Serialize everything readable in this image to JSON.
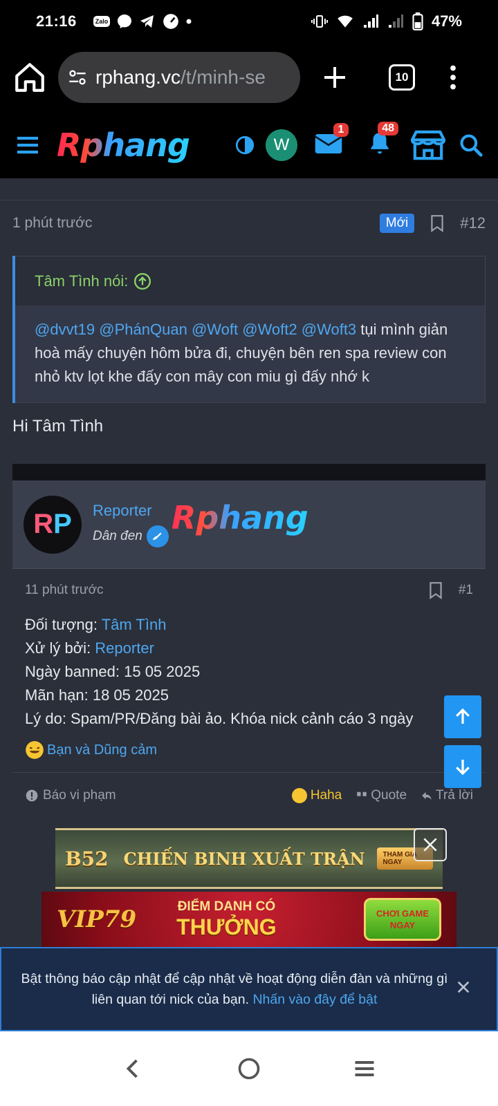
{
  "status_bar": {
    "time": "21:16",
    "zalo": "Zalo",
    "battery": "47%"
  },
  "browser": {
    "url_domain": "rphang.vc",
    "url_path": "/t/minh-se",
    "tab_count": "10"
  },
  "site_header": {
    "logo": "Rphang",
    "avatar_letter": "W",
    "inbox_count": "1",
    "alerts_count": "48"
  },
  "post": {
    "time": "1 phút trước",
    "new_badge": "Mới",
    "number": "#12",
    "quote": {
      "author": "Tâm Tình nói:",
      "mentions": [
        "@dvvt19",
        "@PhánQuan",
        "@Woft",
        "@Woft2",
        "@Woft3"
      ],
      "text": "tụi mình giản hoà mấy chuyện hôm bửa đi, chuyện bên ren spa review con nhỏ ktv lọt khe đấy con mây con miu gì đấy nhớ k"
    },
    "reply": "Hi Tâm Tình",
    "embed": {
      "avatar_initials_1": "R",
      "avatar_initials_2": "P",
      "username": "Reporter",
      "user_title": "Dân đen",
      "logo": "Rphang",
      "time": "11 phút trước",
      "number": "#1",
      "lines": [
        {
          "label": "Đối tượng: ",
          "value": "Tâm Tình"
        },
        {
          "label": "Xử lý bởi: ",
          "value": "Reporter"
        },
        {
          "label": "Ngày banned: 15 05 2025"
        },
        {
          "label": "Mãn hạn: 18 05 2025"
        },
        {
          "label": "Lý do: Spam/PR/Đăng bài ảo. Khóa nick cảnh cáo 3 ngày"
        }
      ],
      "reactions": "Bạn và Dũng cảm",
      "footer": {
        "report": "Báo vi phạm",
        "haha": "Haha",
        "quote": "Quote",
        "reply": "Trả lời"
      }
    }
  },
  "ads": {
    "ad1": {
      "logo": "B52",
      "text": "CHIẾN BINH XUẤT TRẬN",
      "button": "THAM GIA NGAY"
    },
    "ad2": {
      "logo": "VIP79",
      "line1": "ĐIỂM DANH CÓ",
      "line2": "THƯỞNG",
      "button_line1": "CHƠI GAME",
      "button_line2": "NGAY"
    }
  },
  "notification_banner": {
    "text": "Bật thông báo cập nhật để cập nhật về hoạt động diễn đàn và những gì liên quan tới nick của bạn.",
    "link": "Nhấn vào đây để bật"
  },
  "colors": {
    "accent": "#2196f3",
    "link": "#4ea7f0",
    "quote_author": "#8bd16a",
    "bg": "#2b2f3a"
  }
}
